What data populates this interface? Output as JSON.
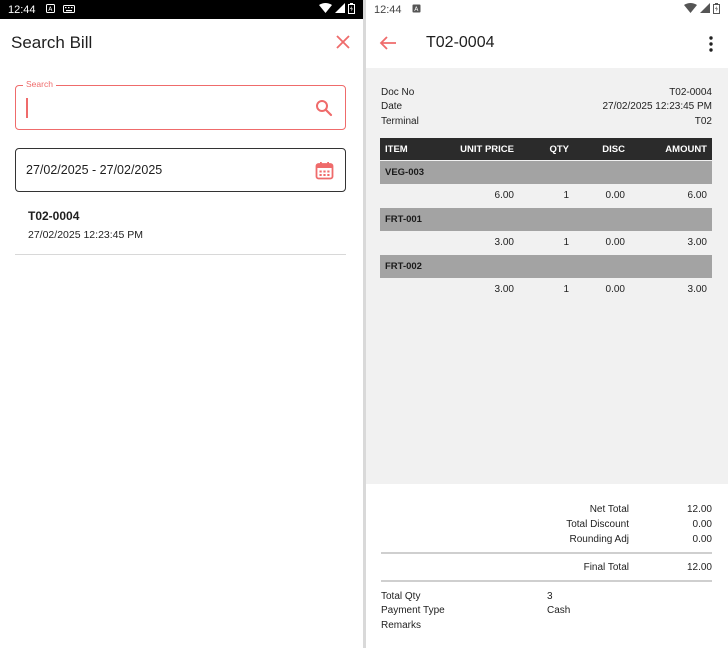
{
  "left_panel": {
    "status": {
      "time": "12:44"
    },
    "title": "Search Bill",
    "search": {
      "label": "Search",
      "value": "",
      "placeholder": ""
    },
    "date_range": "27/02/2025 - 27/02/2025",
    "results": [
      {
        "doc_no": "T02-0004",
        "datetime": "27/02/2025 12:23:45 PM"
      }
    ]
  },
  "right_panel": {
    "status": {
      "time": "12:44"
    },
    "title": "T02-0004",
    "meta": {
      "doc_no_label": "Doc No",
      "doc_no": "T02-0004",
      "date_label": "Date",
      "date": "27/02/2025 12:23:45 PM",
      "terminal_label": "Terminal",
      "terminal": "T02"
    },
    "table": {
      "headers": [
        "ITEM",
        "UNIT PRICE",
        "QTY",
        "DISC",
        "AMOUNT"
      ],
      "items": [
        {
          "code": "VEG-003",
          "unit_price": "6.00",
          "qty": "1",
          "disc": "0.00",
          "amount": "6.00"
        },
        {
          "code": "FRT-001",
          "unit_price": "3.00",
          "qty": "1",
          "disc": "0.00",
          "amount": "3.00"
        },
        {
          "code": "FRT-002",
          "unit_price": "3.00",
          "qty": "1",
          "disc": "0.00",
          "amount": "3.00"
        }
      ]
    },
    "totals": {
      "net_total_label": "Net Total",
      "net_total": "12.00",
      "total_discount_label": "Total Discount",
      "total_discount": "0.00",
      "rounding_label": "Rounding Adj",
      "rounding": "0.00",
      "final_total_label": "Final Total",
      "final_total": "12.00"
    },
    "info": {
      "total_qty_label": "Total Qty",
      "total_qty": "3",
      "payment_type_label": "Payment Type",
      "payment_type": "Cash",
      "remarks_label": "Remarks",
      "remarks": ""
    }
  },
  "colors": {
    "accent": "#ef6b6b",
    "header_dark": "#2b2b2b",
    "item_band": "#a3a3a3",
    "detail_bg": "#f1f1f1"
  }
}
